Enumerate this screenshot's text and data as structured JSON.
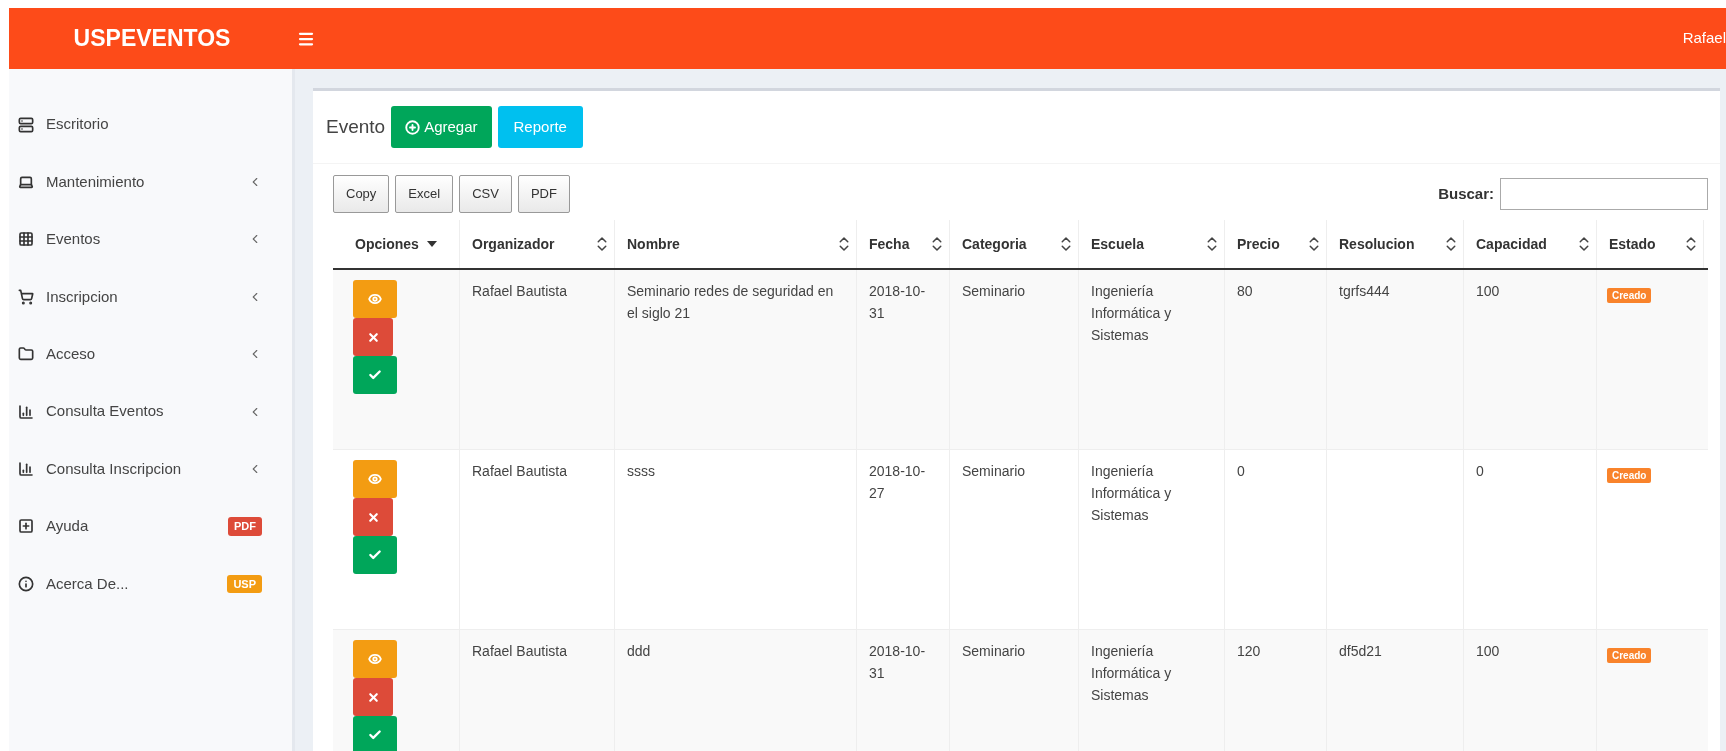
{
  "header": {
    "logo": "USPEVENTOS",
    "user": "Rafael"
  },
  "sidebar": {
    "items": [
      {
        "label": "Escritorio",
        "expandable": false
      },
      {
        "label": "Mantenimiento",
        "expandable": true
      },
      {
        "label": "Eventos",
        "expandable": true
      },
      {
        "label": "Inscripcion",
        "expandable": true
      },
      {
        "label": "Acceso",
        "expandable": true
      },
      {
        "label": "Consulta Eventos",
        "expandable": true
      },
      {
        "label": "Consulta Inscripcion",
        "expandable": true
      },
      {
        "label": "Ayuda",
        "expandable": false,
        "badge": {
          "text": "PDF",
          "color": "#dd4b39"
        }
      },
      {
        "label": "Acerca De...",
        "expandable": false,
        "badge": {
          "text": "USP",
          "color": "#f39c12"
        }
      }
    ]
  },
  "panel": {
    "title": "Evento",
    "add_button": "Agregar",
    "report_button": "Reporte"
  },
  "export_buttons": [
    "Copy",
    "Excel",
    "CSV",
    "PDF"
  ],
  "search": {
    "label": "Buscar:"
  },
  "table": {
    "columns": [
      {
        "label": "Opciones",
        "sorted": true
      },
      {
        "label": "Organizador",
        "sorted": false
      },
      {
        "label": "Nombre",
        "sorted": false
      },
      {
        "label": "Fecha",
        "sorted": false
      },
      {
        "label": "Categoria",
        "sorted": false
      },
      {
        "label": "Escuela",
        "sorted": false
      },
      {
        "label": "Precio",
        "sorted": false
      },
      {
        "label": "Resolucion",
        "sorted": false
      },
      {
        "label": "Capacidad",
        "sorted": false
      },
      {
        "label": "Estado",
        "sorted": false
      }
    ],
    "rows": [
      {
        "cells": [
          "",
          "Rafael Bautista",
          "Seminario redes de seguridad en el siglo 21",
          "2018-10-31",
          "Seminario",
          "Ingeniería Informática y Sistemas",
          "80",
          "tgrfs444",
          "100"
        ],
        "status": "Creado"
      },
      {
        "cells": [
          "",
          "Rafael Bautista",
          "ssss",
          "2018-10-27",
          "Seminario",
          "Ingeniería Informática y Sistemas",
          "0",
          "",
          "0"
        ],
        "status": "Creado"
      },
      {
        "cells": [
          "",
          "Rafael Bautista",
          "ddd",
          "2018-10-31",
          "Seminario",
          "Ingeniería Informática y Sistemas",
          "120",
          "df5d21",
          "100"
        ],
        "status": "Creado"
      }
    ]
  }
}
